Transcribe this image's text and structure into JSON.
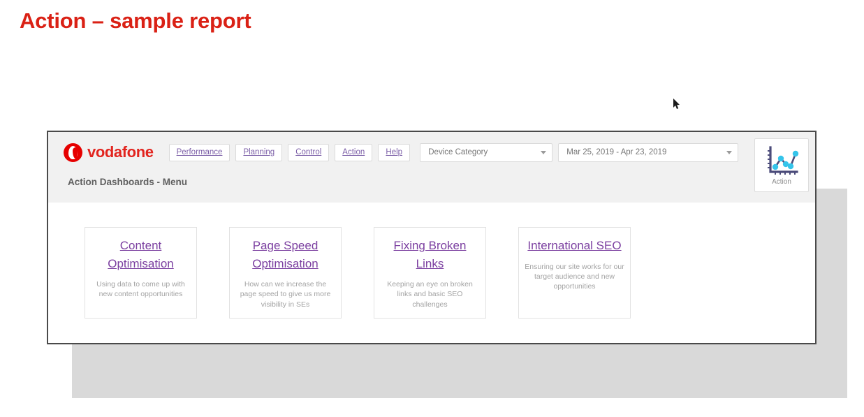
{
  "slide": {
    "title": "Action – sample report",
    "title_color": "#DA2115",
    "backdrop_color": "#d9d9d9"
  },
  "dashboard": {
    "brand": {
      "name": "vodafone",
      "logo_icon": "vodafone-speechmark-icon",
      "brand_color": "#E60000"
    },
    "nav": [
      {
        "label": "Performance"
      },
      {
        "label": "Planning"
      },
      {
        "label": "Control"
      },
      {
        "label": "Action"
      },
      {
        "label": "Help"
      }
    ],
    "filters": {
      "device_category": {
        "label": "Device Category",
        "caret_icon": "chevron-down-icon"
      },
      "date_range": {
        "label": "Mar 25, 2019 - Apr 23, 2019",
        "caret_icon": "chevron-down-icon"
      }
    },
    "action_tile": {
      "label": "Action",
      "icon": "line-chart-icon",
      "node_color": "#35C4EA",
      "axis_color": "#4B4B7A"
    },
    "subtitle": "Action Dashboards - Menu",
    "cards": [
      {
        "title": "Content Optimisation",
        "description": "Using data to come up with new content opportunities"
      },
      {
        "title": "Page Speed Optimisation",
        "description": "How can we increase the page speed to give us more visibility in SEs"
      },
      {
        "title": "Fixing Broken Links",
        "description": "Keeping an eye on broken links and basic SEO challenges"
      },
      {
        "title": "International SEO",
        "description": "Ensuring our site works for our target audience and new opportunities"
      }
    ],
    "link_color": "#7B3FA0"
  },
  "cursor": {
    "icon": "mouse-pointer-icon"
  }
}
